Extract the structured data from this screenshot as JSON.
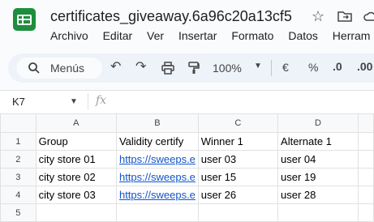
{
  "app": {
    "file_title": "certificates_giveaway.6a96c20a13cf5"
  },
  "menu": [
    "Archivo",
    "Editar",
    "Ver",
    "Insertar",
    "Formato",
    "Datos",
    "Herram"
  ],
  "toolbar": {
    "search_label": "Menús",
    "zoom": "100%",
    "currency": "€",
    "percent": "%",
    "decrease_decimals": ".0",
    "increase_decimals": ".00"
  },
  "namebox": {
    "cell": "K7",
    "fx": "fx"
  },
  "grid": {
    "columns": [
      "A",
      "B",
      "C",
      "D"
    ],
    "rows": [
      {
        "num": "1",
        "cells": [
          "Group",
          "Validity certify",
          "Winner 1",
          "Alternate 1"
        ]
      },
      {
        "num": "2",
        "cells": [
          "city store 01",
          "https://sweeps.e",
          "user 03",
          "user 04"
        ]
      },
      {
        "num": "3",
        "cells": [
          "city store 02",
          "https://sweeps.e",
          "user 15",
          "user 19"
        ]
      },
      {
        "num": "4",
        "cells": [
          "city store 03",
          "https://sweeps.e",
          "user 26",
          "user 28"
        ]
      },
      {
        "num": "5",
        "cells": [
          "",
          "",
          "",
          ""
        ]
      }
    ]
  },
  "colors": {
    "accent": "#1e8e3e",
    "link": "#1155cc"
  }
}
